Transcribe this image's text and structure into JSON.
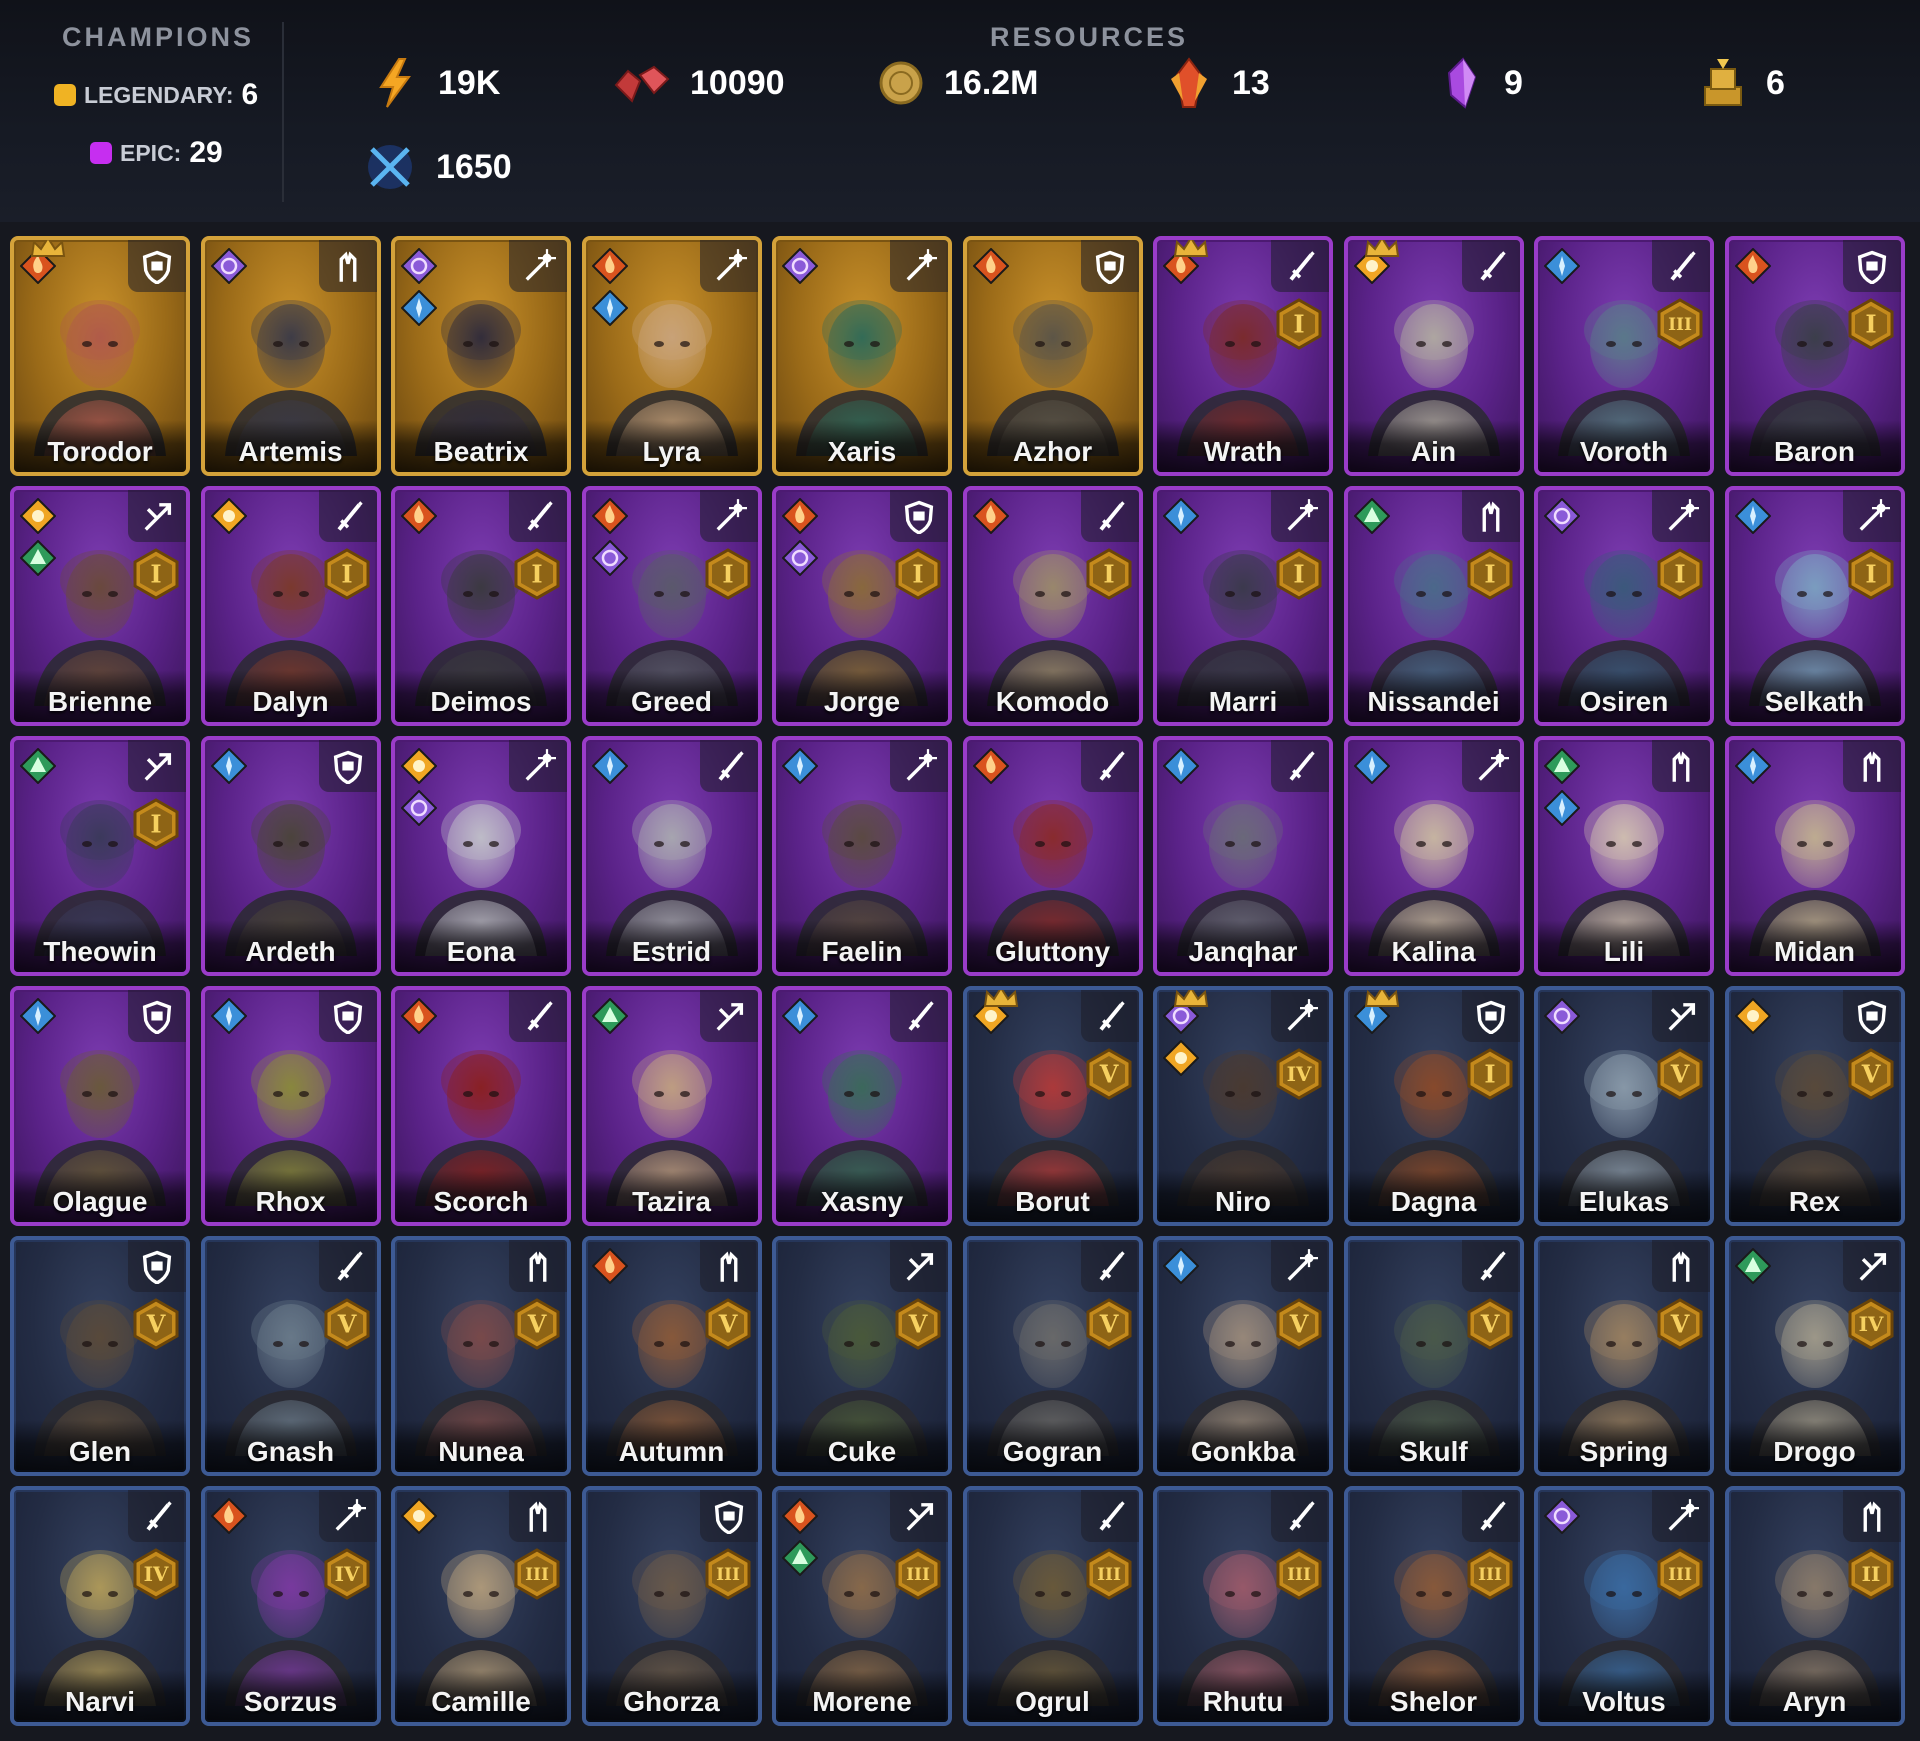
{
  "champions": {
    "title": "CHAMPIONS",
    "legendary_label": "LEGENDARY:",
    "legendary_count": "6",
    "epic_label": "EPIC:",
    "epic_count": "29"
  },
  "resources": {
    "title": "RESOURCES",
    "items": [
      {
        "icon": "energy-icon",
        "value": "19K"
      },
      {
        "icon": "rubies-icon",
        "value": "10090"
      },
      {
        "icon": "gold-coin-icon",
        "value": "16.2M"
      },
      {
        "icon": "fire-crystal-icon",
        "value": "13"
      },
      {
        "icon": "purple-crystal-icon",
        "value": "9"
      },
      {
        "icon": "gold-trophy-icon",
        "value": "6"
      },
      {
        "icon": "crossed-swords-icon",
        "value": "1650"
      }
    ]
  },
  "colors": {
    "legendary": "#d4a23a",
    "epic": "#9a3cc9",
    "rare": "#3d5a94",
    "fire": "#d9531e",
    "ice": "#3b8fd9",
    "storm": "#8a5ad8",
    "earth": "#2e9a5a",
    "sun": "#f0a623"
  },
  "cards": [
    {
      "name": "Torodor",
      "rarity": "legendary",
      "affinity": "fire",
      "role": "defense-icon",
      "crown": true,
      "asc": "",
      "hue": "#b05a4a"
    },
    {
      "name": "Artemis",
      "rarity": "legendary",
      "affinity": "storm",
      "role": "support-icon",
      "crown": false,
      "asc": "",
      "hue": "#3a3a48"
    },
    {
      "name": "Beatrix",
      "rarity": "legendary",
      "affinity": "storm",
      "affinity2": "ice",
      "role": "magic-icon",
      "crown": false,
      "asc": "",
      "hue": "#2e2a3c"
    },
    {
      "name": "Lyra",
      "rarity": "legendary",
      "affinity": "fire",
      "affinity2": "ice",
      "role": "magic-icon",
      "crown": false,
      "asc": "",
      "hue": "#c8a27a"
    },
    {
      "name": "Xaris",
      "rarity": "legendary",
      "affinity": "storm",
      "role": "magic-icon",
      "crown": false,
      "asc": "",
      "hue": "#2f6a58"
    },
    {
      "name": "Azhor",
      "rarity": "legendary",
      "affinity": "fire",
      "role": "defense-icon",
      "crown": false,
      "asc": "",
      "hue": "#5a5448"
    },
    {
      "name": "Wrath",
      "rarity": "epic",
      "affinity": "fire",
      "role": "attack-icon",
      "crown": true,
      "asc": "I",
      "hue": "#7a2a2a"
    },
    {
      "name": "Ain",
      "rarity": "epic",
      "affinity": "sun",
      "role": "attack-icon",
      "crown": true,
      "asc": "",
      "hue": "#b0aaa0"
    },
    {
      "name": "Voroth",
      "rarity": "epic",
      "affinity": "ice",
      "role": "attack-icon",
      "crown": false,
      "asc": "III",
      "hue": "#5a7a8a"
    },
    {
      "name": "Baron",
      "rarity": "epic",
      "affinity": "fire",
      "role": "defense-icon",
      "crown": false,
      "asc": "I",
      "hue": "#3a3e48"
    },
    {
      "name": "Brienne",
      "rarity": "epic",
      "affinity": "sun",
      "affinity2": "earth",
      "role": "speed-icon",
      "crown": false,
      "asc": "I",
      "hue": "#6a4a3a"
    },
    {
      "name": "Dalyn",
      "rarity": "epic",
      "affinity": "sun",
      "role": "attack-icon",
      "crown": false,
      "asc": "I",
      "hue": "#7a3a2a"
    },
    {
      "name": "Deimos",
      "rarity": "epic",
      "affinity": "fire",
      "role": "attack-icon",
      "crown": false,
      "asc": "I",
      "hue": "#3a3a3e"
    },
    {
      "name": "Greed",
      "rarity": "epic",
      "affinity": "fire",
      "affinity2": "storm",
      "role": "magic-icon",
      "crown": false,
      "asc": "I",
      "hue": "#5a5a6a"
    },
    {
      "name": "Jorge",
      "rarity": "epic",
      "affinity": "fire",
      "affinity2": "storm",
      "role": "defense-icon",
      "crown": false,
      "asc": "I",
      "hue": "#8a6a3a"
    },
    {
      "name": "Komodo",
      "rarity": "epic",
      "affinity": "fire",
      "role": "attack-icon",
      "crown": false,
      "asc": "I",
      "hue": "#9a8a6a"
    },
    {
      "name": "Marri",
      "rarity": "epic",
      "affinity": "ice",
      "role": "magic-icon",
      "crown": false,
      "asc": "I",
      "hue": "#3a3a4a"
    },
    {
      "name": "Nissandei",
      "rarity": "epic",
      "affinity": "earth",
      "role": "support-icon",
      "crown": false,
      "asc": "I",
      "hue": "#4a6a8a"
    },
    {
      "name": "Osiren",
      "rarity": "epic",
      "affinity": "storm",
      "role": "magic-icon",
      "crown": false,
      "asc": "I",
      "hue": "#3a5a7a"
    },
    {
      "name": "Selkath",
      "rarity": "epic",
      "affinity": "ice",
      "role": "magic-icon",
      "crown": false,
      "asc": "I",
      "hue": "#7aa0c0"
    },
    {
      "name": "Theowin",
      "rarity": "epic",
      "affinity": "earth",
      "role": "speed-icon",
      "crown": false,
      "asc": "I",
      "hue": "#3a3a5a"
    },
    {
      "name": "Ardeth",
      "rarity": "epic",
      "affinity": "ice",
      "role": "defense-icon",
      "crown": false,
      "asc": "",
      "hue": "#4a4438"
    },
    {
      "name": "Eona",
      "rarity": "epic",
      "affinity": "sun",
      "affinity2": "storm",
      "role": "magic-icon",
      "crown": false,
      "asc": "",
      "hue": "#c0c0c8"
    },
    {
      "name": "Estrid",
      "rarity": "epic",
      "affinity": "ice",
      "role": "attack-icon",
      "crown": false,
      "asc": "",
      "hue": "#a8a8b0"
    },
    {
      "name": "Faelin",
      "rarity": "epic",
      "affinity": "ice",
      "role": "magic-icon",
      "crown": false,
      "asc": "",
      "hue": "#5a4a40"
    },
    {
      "name": "Gluttony",
      "rarity": "epic",
      "affinity": "fire",
      "role": "attack-icon",
      "crown": false,
      "asc": "",
      "hue": "#8a2a2a"
    },
    {
      "name": "Janqhar",
      "rarity": "epic",
      "affinity": "ice",
      "role": "attack-icon",
      "crown": false,
      "asc": "",
      "hue": "#6a6a78"
    },
    {
      "name": "Kalina",
      "rarity": "epic",
      "affinity": "ice",
      "role": "magic-icon",
      "crown": false,
      "asc": "",
      "hue": "#c8b8a0"
    },
    {
      "name": "Lili",
      "rarity": "epic",
      "affinity": "earth",
      "affinity2": "ice",
      "role": "support-icon",
      "crown": false,
      "asc": "",
      "hue": "#d0c0b0"
    },
    {
      "name": "Midan",
      "rarity": "epic",
      "affinity": "ice",
      "role": "support-icon",
      "crown": false,
      "asc": "",
      "hue": "#c0b090"
    },
    {
      "name": "Olague",
      "rarity": "epic",
      "affinity": "ice",
      "role": "defense-icon",
      "crown": false,
      "asc": "",
      "hue": "#6a5a3a"
    },
    {
      "name": "Rhox",
      "rarity": "epic",
      "affinity": "ice",
      "role": "defense-icon",
      "crown": false,
      "asc": "",
      "hue": "#8a8a3a"
    },
    {
      "name": "Scorch",
      "rarity": "epic",
      "affinity": "fire",
      "role": "attack-icon",
      "crown": false,
      "asc": "",
      "hue": "#8a2020"
    },
    {
      "name": "Tazira",
      "rarity": "epic",
      "affinity": "earth",
      "role": "speed-icon",
      "crown": false,
      "asc": "",
      "hue": "#c0a080"
    },
    {
      "name": "Xasny",
      "rarity": "epic",
      "affinity": "ice",
      "role": "attack-icon",
      "crown": false,
      "asc": "",
      "hue": "#3a6a5a"
    },
    {
      "name": "Borut",
      "rarity": "rare",
      "affinity": "sun",
      "role": "attack-icon",
      "crown": true,
      "asc": "V",
      "hue": "#b03a3a"
    },
    {
      "name": "Niro",
      "rarity": "rare",
      "affinity": "storm",
      "affinity2": "sun",
      "role": "magic-icon",
      "crown": true,
      "asc": "IV",
      "hue": "#4a3a30"
    },
    {
      "name": "Dagna",
      "rarity": "rare",
      "affinity": "ice",
      "role": "defense-icon",
      "crown": true,
      "asc": "I",
      "hue": "#8a4a2a"
    },
    {
      "name": "Elukas",
      "rarity": "rare",
      "affinity": "storm",
      "role": "speed-icon",
      "crown": false,
      "asc": "V",
      "hue": "#8a9aaa"
    },
    {
      "name": "Rex",
      "rarity": "rare",
      "affinity": "sun",
      "role": "defense-icon",
      "crown": false,
      "asc": "V",
      "hue": "#5a4a3a"
    },
    {
      "name": "Glen",
      "rarity": "rare",
      "affinity": "",
      "role": "defense-icon",
      "crown": false,
      "asc": "V",
      "hue": "#5a4a3a"
    },
    {
      "name": "Gnash",
      "rarity": "rare",
      "affinity": "",
      "role": "attack-icon",
      "crown": false,
      "asc": "V",
      "hue": "#6a7a8a"
    },
    {
      "name": "Nunea",
      "rarity": "rare",
      "affinity": "",
      "role": "support-icon",
      "crown": false,
      "asc": "V",
      "hue": "#7a4a4a"
    },
    {
      "name": "Autumn",
      "rarity": "rare",
      "affinity": "fire",
      "role": "support-icon",
      "crown": false,
      "asc": "V",
      "hue": "#8a5a3a"
    },
    {
      "name": "Cuke",
      "rarity": "rare",
      "affinity": "",
      "role": "speed-icon",
      "crown": false,
      "asc": "V",
      "hue": "#4a5a3a"
    },
    {
      "name": "Gogran",
      "rarity": "rare",
      "affinity": "",
      "role": "attack-icon",
      "crown": false,
      "asc": "V",
      "hue": "#6a6a6a"
    },
    {
      "name": "Gonkba",
      "rarity": "rare",
      "affinity": "ice",
      "role": "magic-icon",
      "crown": false,
      "asc": "V",
      "hue": "#9a8a7a"
    },
    {
      "name": "Skulf",
      "rarity": "rare",
      "affinity": "",
      "role": "attack-icon",
      "crown": false,
      "asc": "V",
      "hue": "#4a5a4a"
    },
    {
      "name": "Spring",
      "rarity": "rare",
      "affinity": "",
      "role": "support-icon",
      "crown": false,
      "asc": "V",
      "hue": "#9a8060"
    },
    {
      "name": "Drogo",
      "rarity": "rare",
      "affinity": "earth",
      "role": "speed-icon",
      "crown": false,
      "asc": "IV",
      "hue": "#a09a8a"
    },
    {
      "name": "Narvi",
      "rarity": "rare",
      "affinity": "",
      "role": "attack-icon",
      "crown": false,
      "asc": "IV",
      "hue": "#b09a5a"
    },
    {
      "name": "Sorzus",
      "rarity": "rare",
      "affinity": "fire",
      "role": "magic-icon",
      "crown": false,
      "asc": "IV",
      "hue": "#7a3aa0"
    },
    {
      "name": "Camille",
      "rarity": "rare",
      "affinity": "sun",
      "role": "support-icon",
      "crown": false,
      "asc": "III",
      "hue": "#b09a7a"
    },
    {
      "name": "Ghorza",
      "rarity": "rare",
      "affinity": "",
      "role": "defense-icon",
      "crown": false,
      "asc": "III",
      "hue": "#6a5a4a"
    },
    {
      "name": "Morene",
      "rarity": "rare",
      "affinity": "fire",
      "affinity2": "earth",
      "role": "speed-icon",
      "crown": false,
      "asc": "III",
      "hue": "#8a6a4a"
    },
    {
      "name": "Ogrul",
      "rarity": "rare",
      "affinity": "",
      "role": "attack-icon",
      "crown": false,
      "asc": "III",
      "hue": "#6a5a3a"
    },
    {
      "name": "Rhutu",
      "rarity": "rare",
      "affinity": "",
      "role": "attack-icon",
      "crown": false,
      "asc": "III",
      "hue": "#9a5a6a"
    },
    {
      "name": "Shelor",
      "rarity": "rare",
      "affinity": "",
      "role": "attack-icon",
      "crown": false,
      "asc": "III",
      "hue": "#8a5a3a"
    },
    {
      "name": "Voltus",
      "rarity": "rare",
      "affinity": "storm",
      "role": "magic-icon",
      "crown": false,
      "asc": "III",
      "hue": "#3a6aa0"
    },
    {
      "name": "Aryn",
      "rarity": "rare",
      "affinity": "",
      "role": "support-icon",
      "crown": false,
      "asc": "II",
      "hue": "#8a7a6a"
    }
  ]
}
